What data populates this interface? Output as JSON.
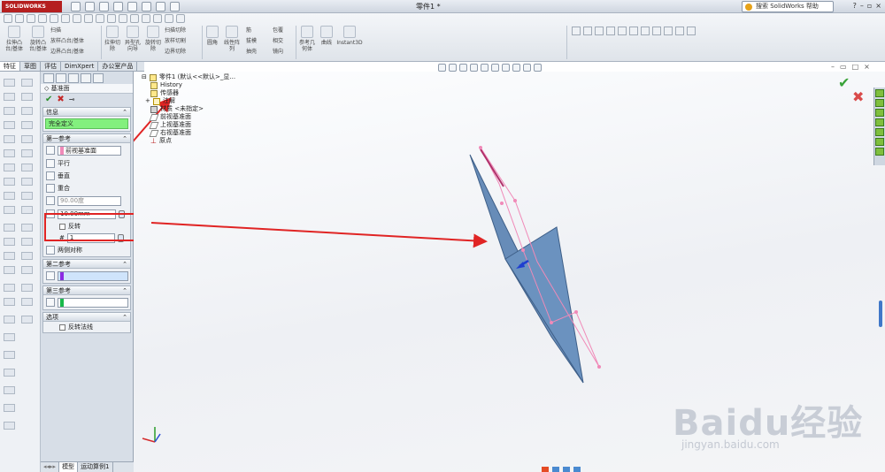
{
  "app": {
    "logo": "SOLIDWORKS",
    "document_title": "零件1 *",
    "search_placeholder": "搜索 SolidWorks 帮助"
  },
  "command_manager": {
    "commands": [
      {
        "label": "拉伸凸台/基体"
      },
      {
        "label": "旋转凸台/基体"
      },
      {
        "label": "扫描"
      },
      {
        "label": "放样凸台/基体"
      },
      {
        "label": "边界凸台/基体"
      },
      {
        "label": "拉伸切除"
      },
      {
        "label": "异型孔向导"
      },
      {
        "label": "旋转切除"
      },
      {
        "label": "扫描切除"
      },
      {
        "label": "放样切割"
      },
      {
        "label": "边界切除"
      },
      {
        "label": "圆角"
      },
      {
        "label": "线性阵列"
      },
      {
        "label": "筋"
      },
      {
        "label": "拔模"
      },
      {
        "label": "抽壳"
      },
      {
        "label": "包覆"
      },
      {
        "label": "相交"
      },
      {
        "label": "镜向"
      },
      {
        "label": "参考几何体"
      },
      {
        "label": "曲线"
      },
      {
        "label": "Instant3D"
      }
    ]
  },
  "tabs": [
    {
      "label": "特征"
    },
    {
      "label": "草图"
    },
    {
      "label": "评估"
    },
    {
      "label": "DimXpert"
    },
    {
      "label": "办公室产品"
    }
  ],
  "property_manager": {
    "title": "基准面",
    "message_section": {
      "title": "信息",
      "text": "完全定义"
    },
    "first_ref": {
      "title": "第一参考",
      "selection": "前视基准面",
      "options": [
        "平行",
        "垂直",
        "重合"
      ],
      "angle": "90.00度",
      "distance": "10.00mm",
      "flip_label": "反转",
      "count": "1",
      "symmetric_label": "两侧对称"
    },
    "second_ref": {
      "title": "第二参考"
    },
    "third_ref": {
      "title": "第三参考"
    },
    "options_section": {
      "title": "选项",
      "flip_normal_label": "反转法线"
    }
  },
  "feature_tree": {
    "root": "零件1 (默认<<默认>_显...",
    "items": [
      {
        "label": "History",
        "icon": "history"
      },
      {
        "label": "传感器",
        "icon": "sensor"
      },
      {
        "label": "注解",
        "icon": "annotation"
      },
      {
        "label": "材质 <未指定>",
        "icon": "material"
      },
      {
        "label": "前视基准面",
        "icon": "plane"
      },
      {
        "label": "上视基准面",
        "icon": "plane"
      },
      {
        "label": "右视基准面",
        "icon": "plane"
      },
      {
        "label": "原点",
        "icon": "origin"
      }
    ]
  },
  "bottom_tabs": [
    {
      "label": "模型"
    },
    {
      "label": "运动算例1"
    }
  ],
  "colors": {
    "accent_red": "#e02424",
    "plane_fill": "#5f86b4",
    "preview_pink": "#f08ab8",
    "green_msg": "#83f07e"
  },
  "watermark": {
    "brand": "Baidu经验",
    "url": "jingyan.baidu.com"
  }
}
